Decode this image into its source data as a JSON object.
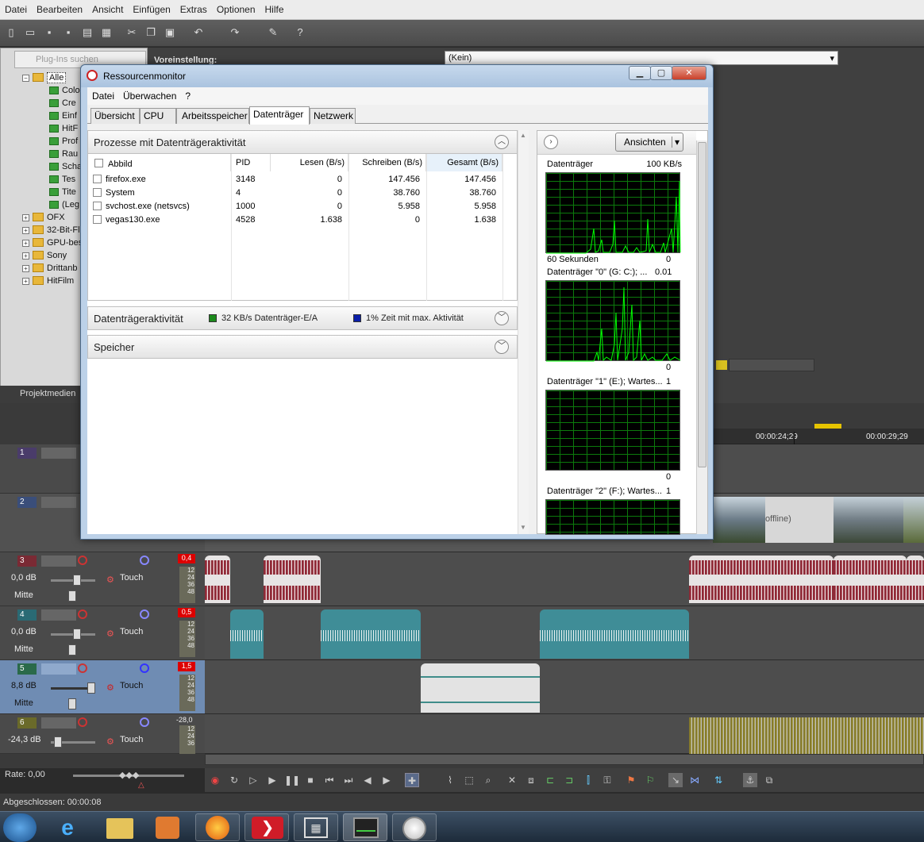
{
  "vegas": {
    "menu": [
      "Datei",
      "Bearbeiten",
      "Ansicht",
      "Einfügen",
      "Extras",
      "Optionen",
      "Hilfe"
    ],
    "search_placeholder": "Plug-Ins suchen",
    "preset_label": "Voreinstellung:",
    "preset_value": "(Kein)",
    "tree": [
      {
        "label": "Alle",
        "type": "folder"
      },
      {
        "label": "Colo",
        "type": "plug"
      },
      {
        "label": "Cre",
        "type": "plug"
      },
      {
        "label": "Einf",
        "type": "plug"
      },
      {
        "label": "HitF",
        "type": "plug"
      },
      {
        "label": "Prof",
        "type": "plug"
      },
      {
        "label": "Rau",
        "type": "plug"
      },
      {
        "label": "Scha",
        "type": "plug"
      },
      {
        "label": "Tes",
        "type": "plug"
      },
      {
        "label": "Tite",
        "type": "plug"
      },
      {
        "label": "(Leg",
        "type": "plug"
      },
      {
        "label": "OFX",
        "type": "folder"
      },
      {
        "label": "32-Bit-Fl",
        "type": "folder"
      },
      {
        "label": "GPU-bes",
        "type": "folder"
      },
      {
        "label": "Sony",
        "type": "folder"
      },
      {
        "label": "Drittanb",
        "type": "folder"
      },
      {
        "label": "HitFilm",
        "type": "folder"
      }
    ],
    "project_media_tab": "Projektmedien",
    "ruler": {
      "t1": "00:00:24;29",
      "t2": "00:00:29;29"
    },
    "offline_text": "offline)",
    "tracks": [
      {
        "num": "1",
        "kind": "video"
      },
      {
        "num": "2",
        "kind": "video"
      },
      {
        "num": "3",
        "kind": "audio",
        "db": "0,0 dB",
        "pan": "Mitte",
        "mode": "Touch",
        "peak": "0,4"
      },
      {
        "num": "4",
        "kind": "audio",
        "db": "0,0 dB",
        "pan": "Mitte",
        "mode": "Touch",
        "peak": "0,5"
      },
      {
        "num": "5",
        "kind": "audio",
        "db": "8,8 dB",
        "pan": "Mitte",
        "mode": "Touch",
        "peak": "1,5"
      },
      {
        "num": "6",
        "kind": "audio",
        "db": "-24,3 dB",
        "pan": "",
        "mode": "Touch",
        "peak": "-28,0"
      }
    ],
    "meter_scale": [
      "12",
      "24",
      "36",
      "48"
    ],
    "rate": "Rate: 0,00",
    "status": "Abgeschlossen: 00:00:08"
  },
  "resmon": {
    "title": "Ressourcenmonitor",
    "menu": [
      "Datei",
      "Überwachen",
      "?"
    ],
    "tabs": [
      "Übersicht",
      "CPU",
      "Arbeitsspeicher",
      "Datenträger",
      "Netzwerk"
    ],
    "active_tab": "Datenträger",
    "section_processes": "Prozesse mit Datenträgeraktivität",
    "columns": [
      "Abbild",
      "PID",
      "Lesen (B/s)",
      "Schreiben (B/s)",
      "Gesamt (B/s)"
    ],
    "rows": [
      {
        "image": "firefox.exe",
        "pid": "3148",
        "read": "0",
        "write": "147.456",
        "total": "147.456"
      },
      {
        "image": "System",
        "pid": "4",
        "read": "0",
        "write": "38.760",
        "total": "38.760"
      },
      {
        "image": "svchost.exe (netsvcs)",
        "pid": "1000",
        "read": "0",
        "write": "5.958",
        "total": "5.958"
      },
      {
        "image": "vegas130.exe",
        "pid": "4528",
        "read": "1.638",
        "write": "0",
        "total": "1.638"
      }
    ],
    "section_activity": "Datenträgeraktivität",
    "activity_io": "32 KB/s Datenträger-E/A",
    "activity_max": "1% Zeit mit max. Aktivität",
    "section_memory": "Speicher",
    "views_button": "Ansichten",
    "graphs": [
      {
        "label": "Datenträger",
        "max": "100 KB/s",
        "bottom_left": "60 Sekunden",
        "bottom_right": "0"
      },
      {
        "label": "Datenträger \"0\" (G: C:); ...",
        "max": "0.01",
        "bottom_left": "",
        "bottom_right": "0"
      },
      {
        "label": "Datenträger \"1\" (E:); Wartes...",
        "max": "1",
        "bottom_left": "",
        "bottom_right": "0"
      },
      {
        "label": "Datenträger \"2\" (F:); Wartes...",
        "max": "1",
        "bottom_left": "",
        "bottom_right": ""
      }
    ],
    "colors": {
      "graph_line": "#00ff00",
      "io_swatch": "#1c8a1c",
      "max_swatch": "#0a1ea8"
    }
  }
}
